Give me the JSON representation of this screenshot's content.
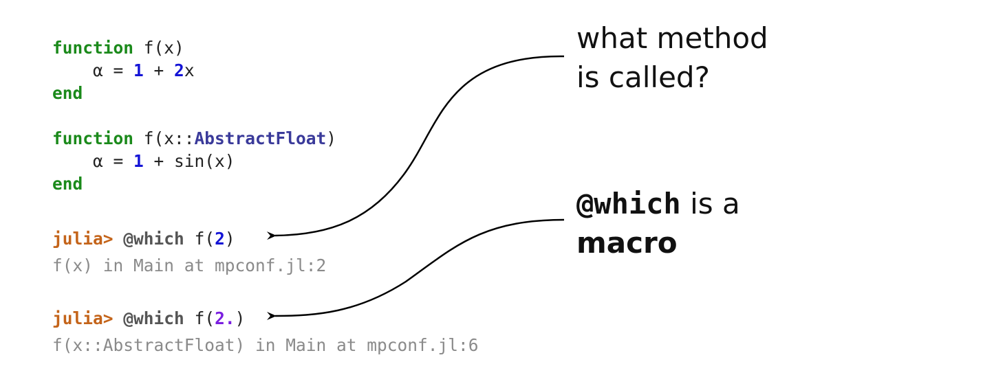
{
  "code_block_1": {
    "line1_kw": "function",
    "line1_rest": " f(x)",
    "line2_a": "    α = ",
    "line2_n1": "1",
    "line2_b": " + ",
    "line2_n2": "2",
    "line2_c": "x",
    "line3_kw": "end"
  },
  "code_block_2": {
    "line1_kw": "function",
    "line1_a": " f(x::",
    "line1_type": "AbstractFloat",
    "line1_b": ")",
    "line2_a": "    α = ",
    "line2_n1": "1",
    "line2_b": " + sin(x)",
    "line3_kw": "end"
  },
  "repl_1": {
    "prompt": "julia>",
    "macro": "@which",
    "call_a": "f(",
    "arg": "2",
    "call_b": ")",
    "output": "f(x) in Main at mpconf.jl:2"
  },
  "repl_2": {
    "prompt": "julia>",
    "macro": "@which",
    "call_a": "f(",
    "arg": "2.",
    "call_b": ")",
    "output": "f(x::AbstractFloat) in Main at mpconf.jl:6"
  },
  "annotation_1": {
    "line1": "what method",
    "line2": "is called?"
  },
  "annotation_2": {
    "code": "@which",
    "text": " is a",
    "bold": "macro"
  },
  "colors": {
    "keyword": "#1b8a1b",
    "number": "#1414d6",
    "type": "#3a3a9a",
    "prompt": "#c4641a",
    "float": "#7a1ee0",
    "output": "#8a8a8a"
  }
}
